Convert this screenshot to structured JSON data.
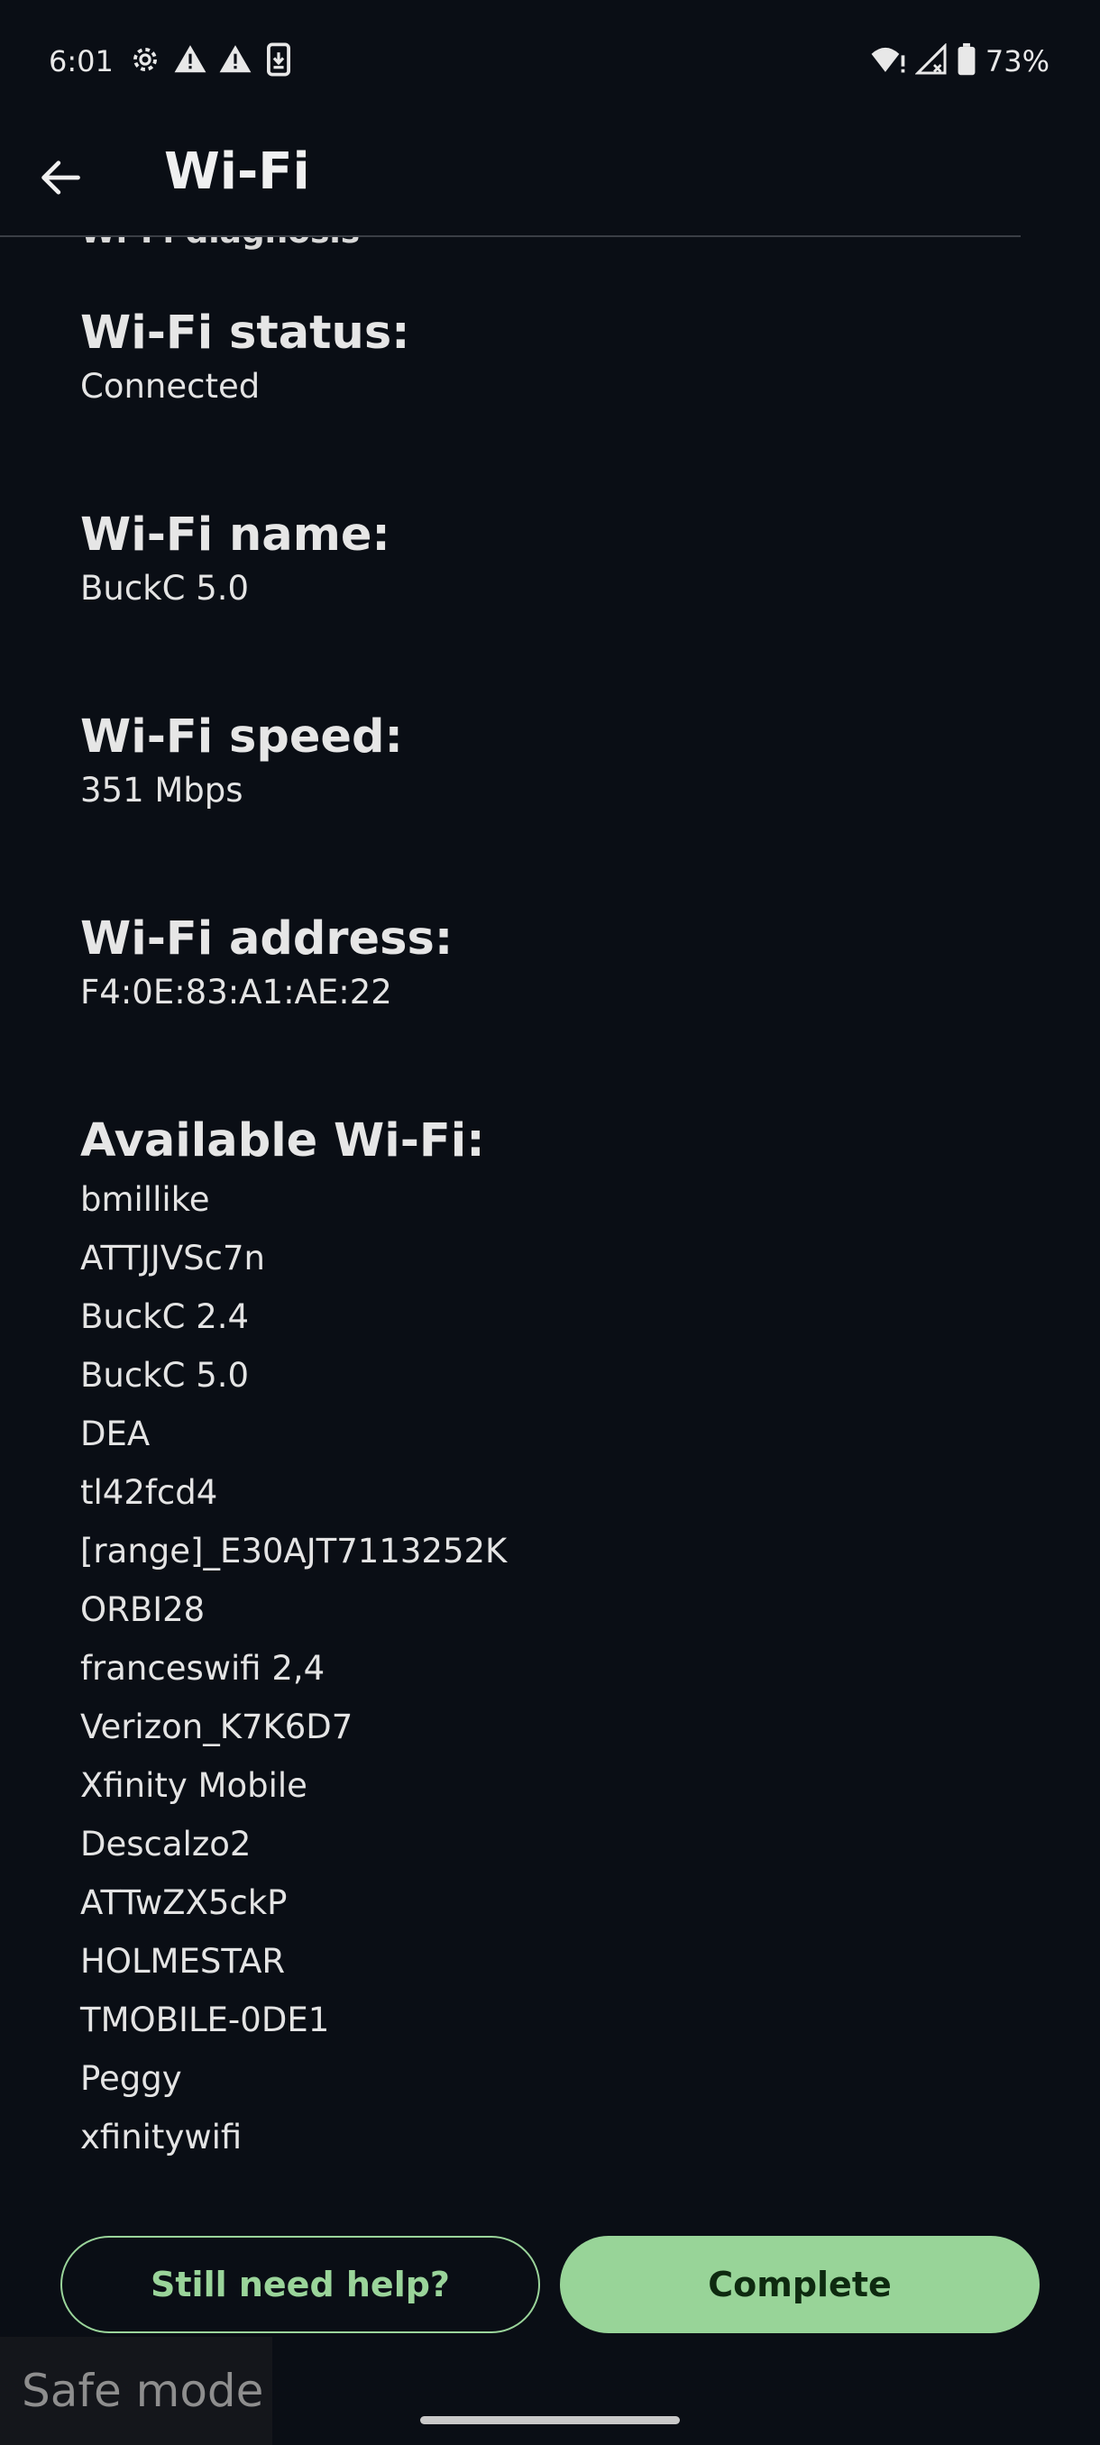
{
  "status_bar": {
    "time": "6:01",
    "battery_percent": "73%",
    "icons_left": [
      "gear-icon",
      "warning-icon",
      "warning-icon",
      "download-icon"
    ],
    "icons_right": [
      "wifi-alert-icon",
      "cellular-signal-icon",
      "battery-icon"
    ]
  },
  "app_bar": {
    "title": "Wi-Fi",
    "back_icon": "arrow-left-icon"
  },
  "diagnosis": {
    "section_title": "Wi-Fi diagnosis",
    "status_label": "Wi-Fi status:",
    "status_value": "Connected",
    "name_label": "Wi-Fi name:",
    "name_value": "BuckC 5.0",
    "speed_label": "Wi-Fi speed:",
    "speed_value": "351 Mbps",
    "address_label": "Wi-Fi address:",
    "address_value": "F4:0E:83:A1:AE:22",
    "available_label": "Available Wi-Fi:",
    "available_networks": [
      "bmillike",
      "ATTJJVSc7n",
      "BuckC 2.4",
      "BuckC 5.0",
      "DEA",
      "tl42fcd4",
      "[range]_E30AJT7113252K",
      "ORBI28",
      "franceswifi 2,4",
      "Verizon_K7K6D7",
      "Xfinity Mobile",
      "Descalzo2",
      "ATTwZX5ckP",
      "HOLMESTAR",
      "TMOBILE-0DE1",
      "Peggy",
      "xfinitywifi"
    ]
  },
  "actions": {
    "help_label": "Still need help?",
    "complete_label": "Complete"
  },
  "system": {
    "safe_mode_label": "Safe mode"
  },
  "colors": {
    "background": "#0a0e15",
    "accent_green": "#98d498",
    "text": "#e4e4e4"
  }
}
